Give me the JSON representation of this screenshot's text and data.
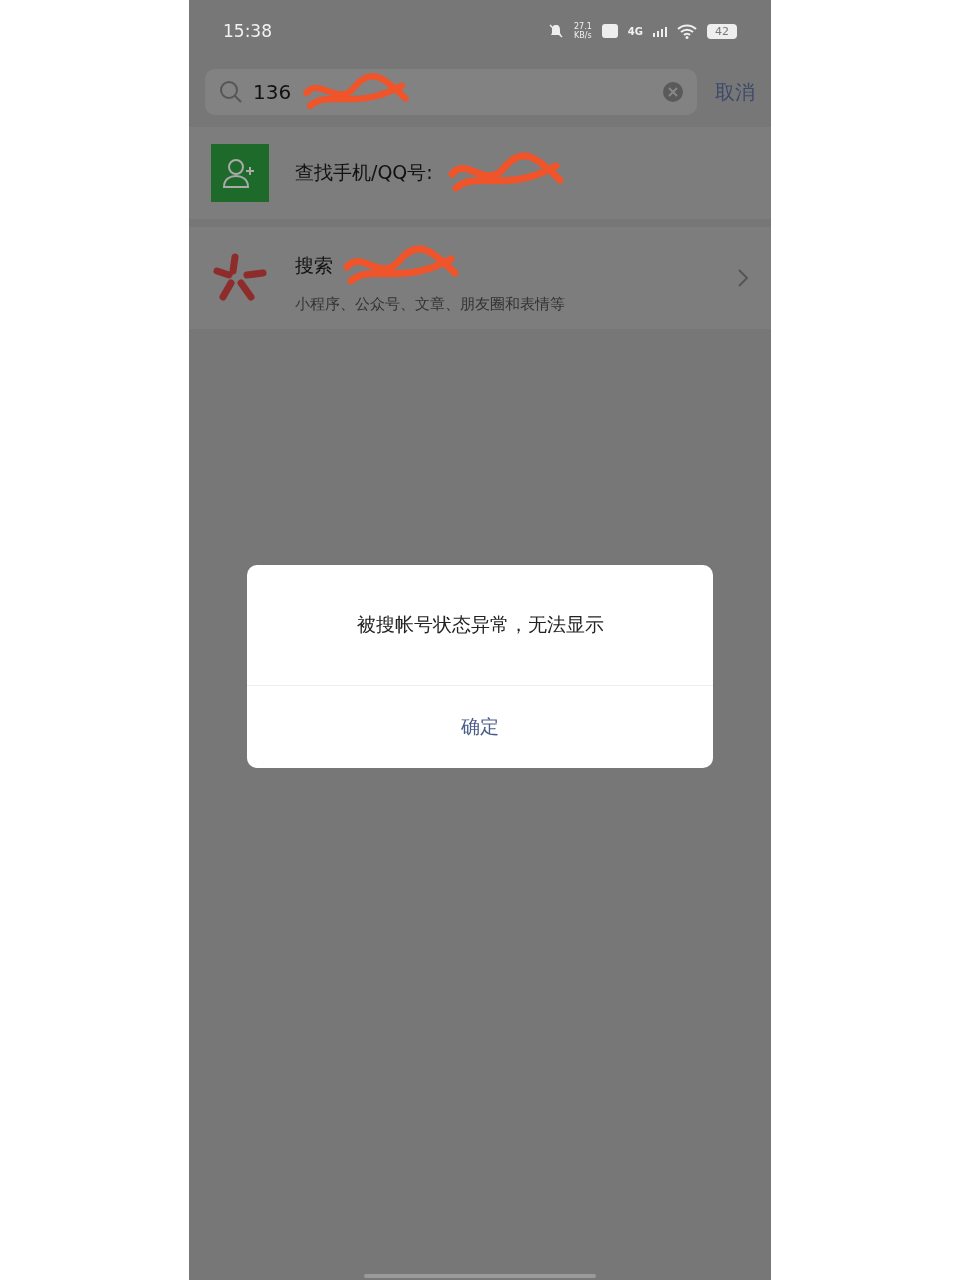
{
  "status_bar": {
    "time": "15:38",
    "speed_value": "27.1",
    "speed_unit": "KB/s",
    "network": "4G",
    "battery": "42"
  },
  "search": {
    "value": "136",
    "redacted": true,
    "cancel": "取消"
  },
  "results": [
    {
      "kind": "contact",
      "label": "查找手机/QQ号:",
      "redacted": true
    },
    {
      "kind": "search",
      "label": "搜索",
      "subtitle": "小程序、公众号、文章、朋友圈和表情等",
      "redacted": true
    }
  ],
  "dialog": {
    "message": "被搜帐号状态异常，无法显示",
    "button": "确定"
  }
}
